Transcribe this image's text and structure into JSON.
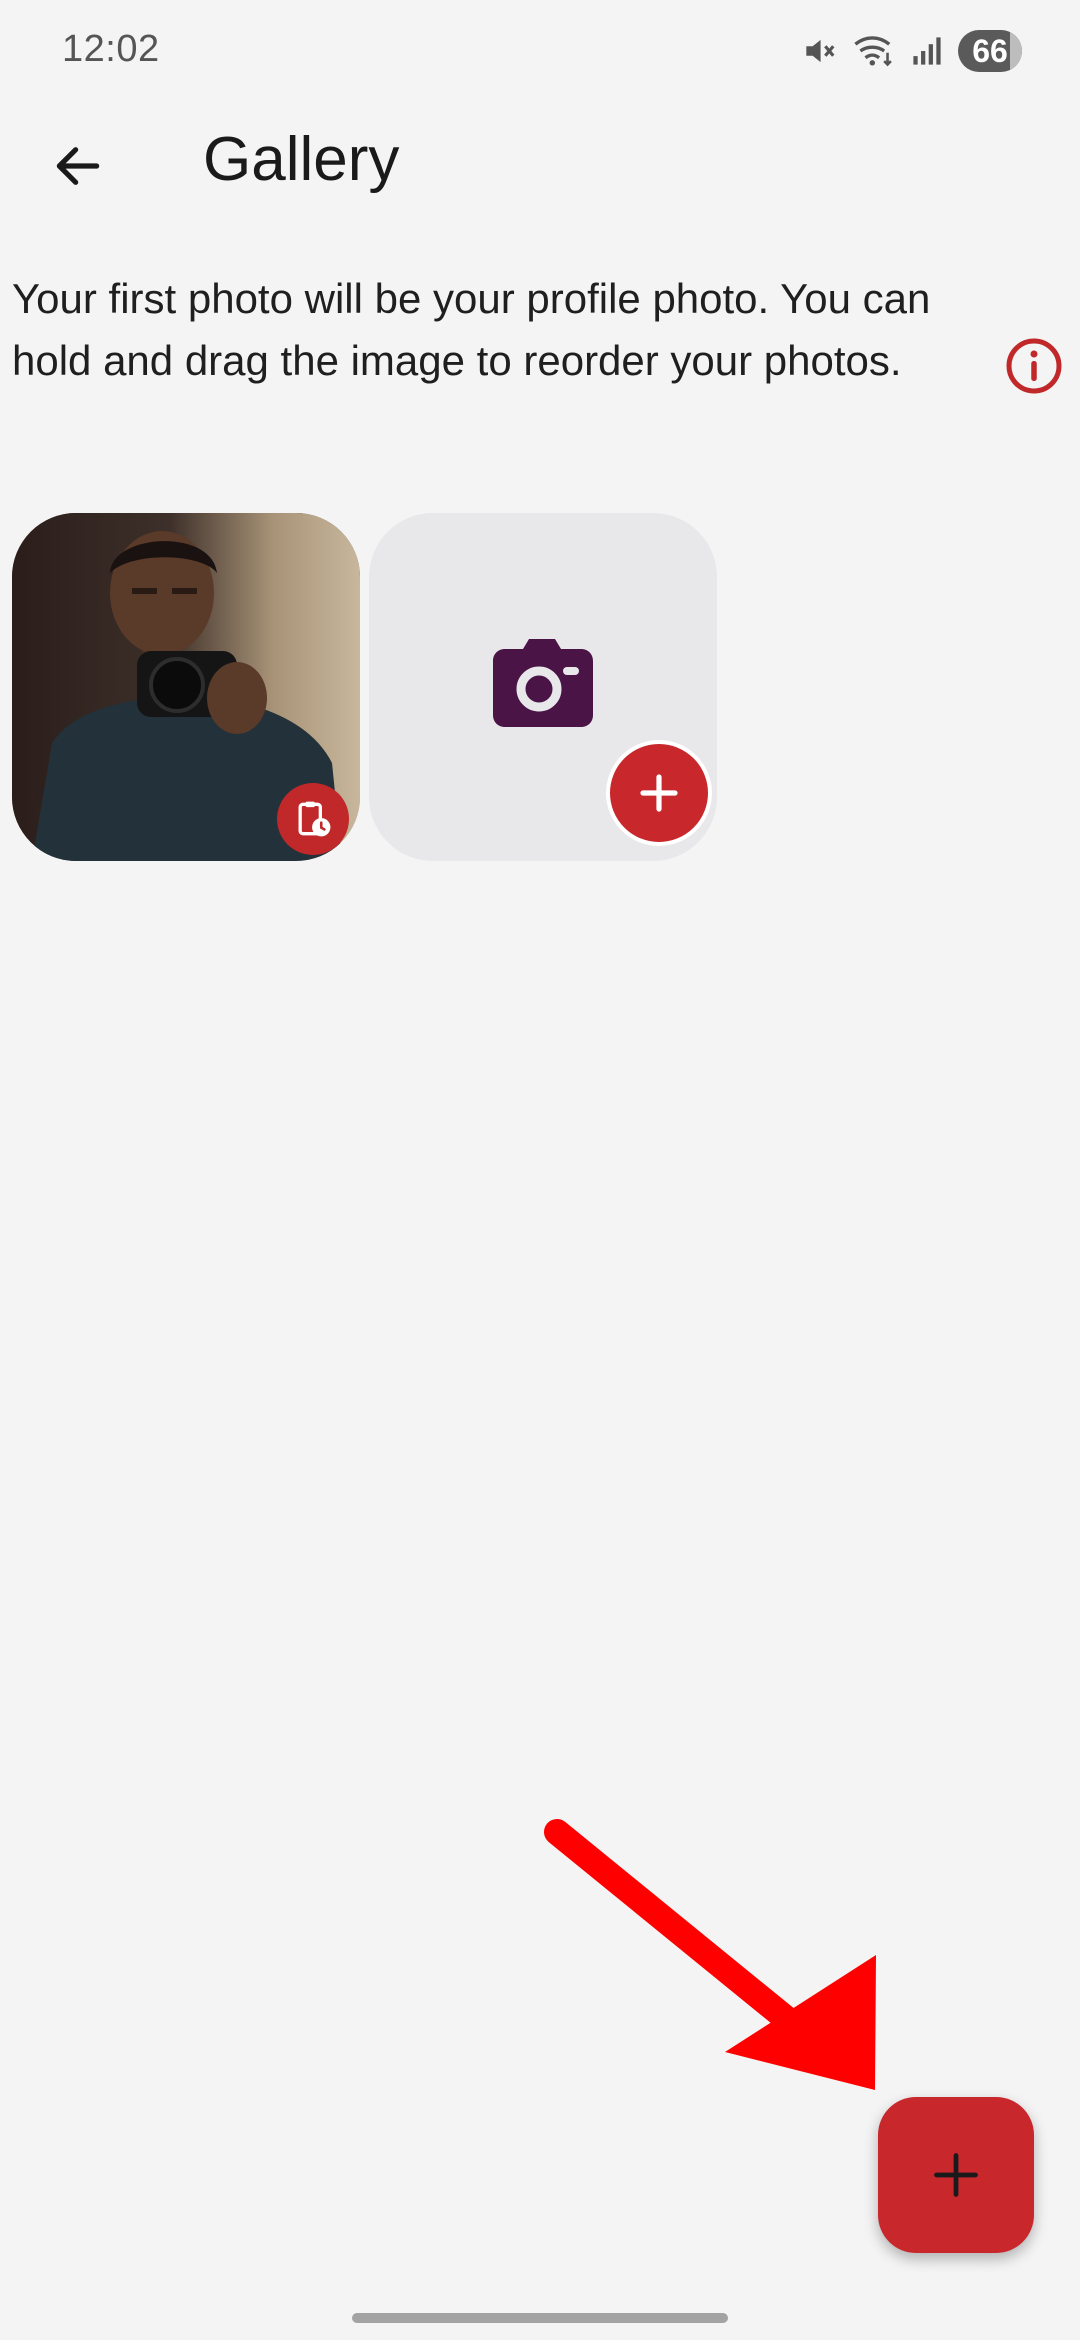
{
  "status_bar": {
    "time": "12:02",
    "battery_level": "66",
    "icons": [
      "mute-icon",
      "wifi-icon",
      "signal-icon",
      "battery-icon"
    ]
  },
  "app_bar": {
    "title": "Gallery",
    "back_icon": "arrow-left-icon"
  },
  "description": {
    "text": "Your first photo will be your profile photo. You can hold and drag the image to reorder your photos.",
    "info_icon": "info-circle-icon"
  },
  "gallery": {
    "photos": [
      {
        "kind": "photo",
        "subject": "profile-photo",
        "badge_icon": "clipboard-clock-icon"
      }
    ],
    "add_tile": {
      "icon": "camera-icon",
      "badge_icon": "plus-icon"
    }
  },
  "fab": {
    "icon": "plus-icon"
  },
  "colors": {
    "background": "#f4f4f4",
    "accent": "#c8282c",
    "camera_icon": "#4a1446",
    "add_tile_bg": "#e8e7ea",
    "annotation_arrow": "#ff0000"
  }
}
